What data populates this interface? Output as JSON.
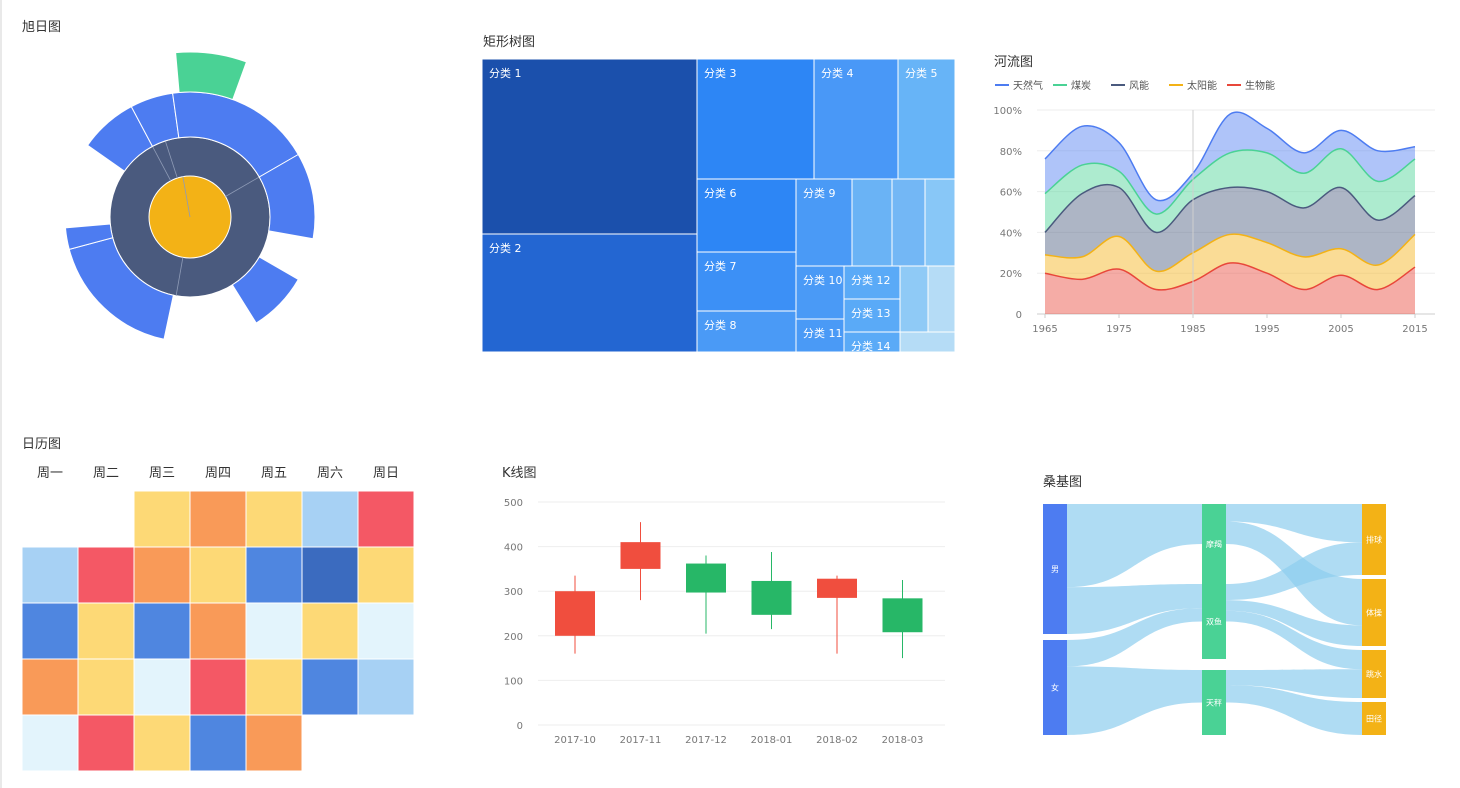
{
  "titles": {
    "sunburst": "旭日图",
    "treemap": "矩形树图",
    "theme_river": "河流图",
    "calendar": "日历图",
    "kline": "K线图",
    "sankey": "桑基图"
  },
  "calendar": {
    "weekdays": [
      "周一",
      "周二",
      "周三",
      "周四",
      "周五",
      "周六",
      "周日"
    ]
  },
  "colors": {
    "blue": "#4d7cf1",
    "dark": "#4a5a7e",
    "gold": "#f3b216",
    "green": "#4ad295",
    "up": "#f04e3e",
    "down": "#27b767"
  },
  "chart_data": [
    {
      "type": "sunburst",
      "title": "旭日图",
      "rings": [
        {
          "level": 1,
          "segments": [
            {
              "value": 1
            }
          ]
        },
        {
          "level": 2,
          "segments": [
            {
              "value": 1
            }
          ]
        },
        {
          "level": 3,
          "segments": [
            {
              "value": 0.21
            },
            {
              "value": 0.12
            },
            {
              "value": 0.11
            },
            {
              "value": 0.12
            },
            {
              "value": 0.07
            },
            {
              "value": 0.14
            },
            {
              "value": 0.1
            },
            {
              "value": 0.13
            }
          ]
        },
        {
          "level": 4,
          "segments": [
            {
              "value": 1
            }
          ]
        }
      ]
    },
    {
      "type": "treemap",
      "title": "矩形树图",
      "items": [
        {
          "name": "分类 1",
          "value": 900
        },
        {
          "name": "分类 2",
          "value": 600
        },
        {
          "name": "分类 3",
          "value": 300
        },
        {
          "name": "分类 4",
          "value": 200
        },
        {
          "name": "分类 5",
          "value": 150
        },
        {
          "name": "分类 6",
          "value": 160
        },
        {
          "name": "分类 7",
          "value": 130
        },
        {
          "name": "分类 8",
          "value": 90
        },
        {
          "name": "分类 9",
          "value": 110
        },
        {
          "name": "分类 10",
          "value": 60
        },
        {
          "name": "分类 11",
          "value": 40
        },
        {
          "name": "分类 12",
          "value": 40
        },
        {
          "name": "分类 13",
          "value": 30
        },
        {
          "name": "分类 14",
          "value": 20
        }
      ]
    },
    {
      "type": "area",
      "title": "河流图",
      "x": [
        1965,
        1970,
        1975,
        1980,
        1985,
        1990,
        1995,
        2000,
        2005,
        2010,
        2015
      ],
      "xticks": [
        "1965",
        "1975",
        "1985",
        "1995",
        "2005",
        "2015"
      ],
      "yticks": [
        "0",
        "20%",
        "40%",
        "60%",
        "80%",
        "100%"
      ],
      "ylim": [
        0,
        1
      ],
      "series": [
        {
          "name": "天然气",
          "color": "#4d7cf1",
          "values": [
            0.17,
            0.19,
            0.14,
            0.07,
            0.03,
            0.19,
            0.12,
            0.1,
            0.09,
            0.15,
            0.06
          ]
        },
        {
          "name": "煤炭",
          "color": "#4ad295",
          "values": [
            0.19,
            0.14,
            0.08,
            0.09,
            0.1,
            0.17,
            0.19,
            0.17,
            0.19,
            0.19,
            0.18
          ]
        },
        {
          "name": "风能",
          "color": "#4a5a7e",
          "values": [
            0.11,
            0.31,
            0.24,
            0.19,
            0.26,
            0.23,
            0.25,
            0.24,
            0.3,
            0.22,
            0.19
          ]
        },
        {
          "name": "太阳能",
          "color": "#f3b216",
          "values": [
            0.09,
            0.11,
            0.16,
            0.09,
            0.14,
            0.14,
            0.15,
            0.16,
            0.13,
            0.12,
            0.16
          ]
        },
        {
          "name": "生物能",
          "color": "#e8473a",
          "values": [
            0.2,
            0.17,
            0.22,
            0.12,
            0.16,
            0.25,
            0.2,
            0.12,
            0.19,
            0.12,
            0.23
          ]
        }
      ]
    },
    {
      "type": "heatmap",
      "title": "日历图",
      "weekdays": [
        "周一",
        "周二",
        "周三",
        "周四",
        "周五",
        "周六",
        "周日"
      ],
      "levels": [
        "#e3f4fc",
        "#a7d1f4",
        "#4f86e0",
        "#3b6bbf",
        "#fdd976",
        "#f99a58",
        "#f45865"
      ],
      "weeks": [
        [
          null,
          null,
          4,
          5,
          4,
          1,
          6
        ],
        [
          1,
          6,
          5,
          4,
          2,
          3,
          4
        ],
        [
          2,
          4,
          2,
          5,
          0,
          4,
          0
        ],
        [
          5,
          4,
          0,
          6,
          4,
          2,
          1
        ],
        [
          0,
          6,
          4,
          2,
          5,
          null,
          null
        ]
      ]
    },
    {
      "type": "candlestick",
      "title": "K线图",
      "categories": [
        "2017-10",
        "2017-11",
        "2017-12",
        "2018-01",
        "2018-02",
        "2018-03"
      ],
      "yticks": [
        "0",
        "100",
        "200",
        "300",
        "400",
        "500"
      ],
      "ylim": [
        0,
        500
      ],
      "candles": [
        {
          "open": 200,
          "close": 300,
          "low": 160,
          "high": 335
        },
        {
          "open": 350,
          "close": 410,
          "low": 280,
          "high": 455
        },
        {
          "open": 362,
          "close": 297,
          "low": 205,
          "high": 380
        },
        {
          "open": 323,
          "close": 247,
          "low": 215,
          "high": 388
        },
        {
          "open": 285,
          "close": 328,
          "low": 160,
          "high": 335
        },
        {
          "open": 284,
          "close": 208,
          "low": 150,
          "high": 325
        }
      ]
    },
    {
      "type": "sankey",
      "title": "桑基图",
      "nodes": [
        {
          "name": "男",
          "column": 0
        },
        {
          "name": "女",
          "column": 0
        },
        {
          "name": "摩羯",
          "column": 1
        },
        {
          "name": "双鱼",
          "column": 1
        },
        {
          "name": "天秤",
          "column": 1
        },
        {
          "name": "排球",
          "column": 2
        },
        {
          "name": "体操",
          "column": 2
        },
        {
          "name": "跳水",
          "column": 2
        },
        {
          "name": "田径",
          "column": 2
        }
      ],
      "links": [
        {
          "source": "男",
          "target": "摩羯",
          "value": 80
        },
        {
          "source": "男",
          "target": "双鱼",
          "value": 45
        },
        {
          "source": "女",
          "target": "双鱼",
          "value": 25
        },
        {
          "source": "女",
          "target": "天秤",
          "value": 65
        },
        {
          "source": "摩羯",
          "target": "排球",
          "value": 35
        },
        {
          "source": "摩羯",
          "target": "体操",
          "value": 45
        },
        {
          "source": "双鱼",
          "target": "排球",
          "value": 30
        },
        {
          "source": "双鱼",
          "target": "体操",
          "value": 20
        },
        {
          "source": "双鱼",
          "target": "跳水",
          "value": 20
        },
        {
          "source": "天秤",
          "target": "跳水",
          "value": 30
        },
        {
          "source": "天秤",
          "target": "田径",
          "value": 35
        }
      ]
    }
  ]
}
